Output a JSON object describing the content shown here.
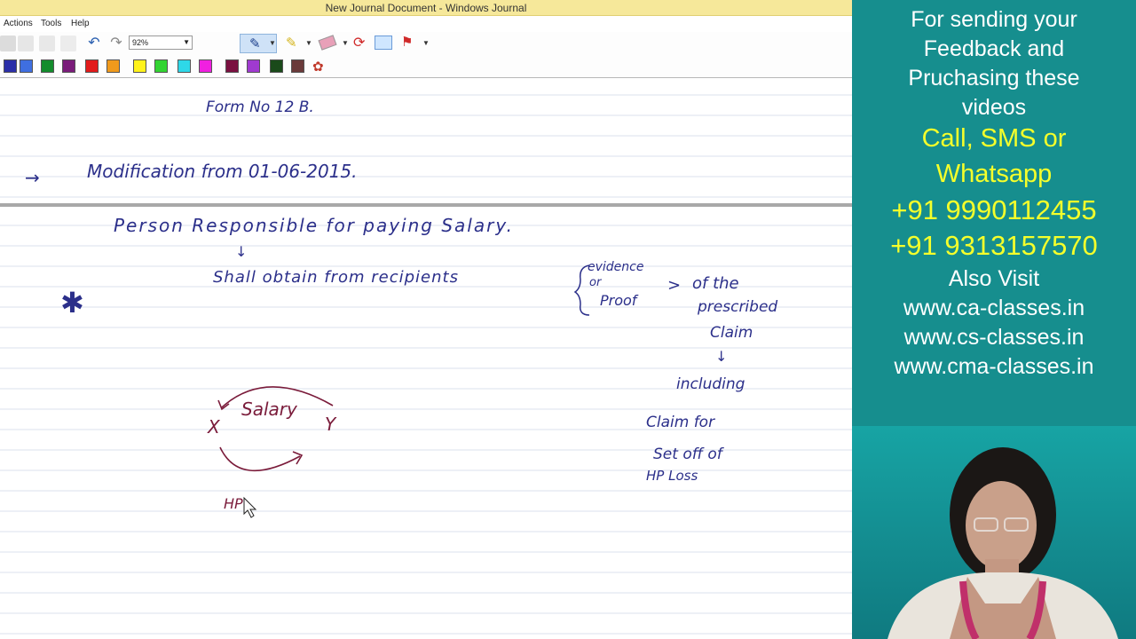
{
  "window": {
    "title": "New Journal Document - Windows Journal"
  },
  "menu": [
    "Actions",
    "Tools",
    "Help"
  ],
  "toolbar": {
    "zoom": "92%"
  },
  "palette": [
    "#2b2fa8",
    "#3f6fe0",
    "#138c2c",
    "#7a1c7a",
    "#e21b1b",
    "#f09a1c",
    "#fff21b",
    "#32d432",
    "#2ed8e8",
    "#f020e0",
    "#7a1040",
    "#a03ad0",
    "#1a4a1a",
    "#6a3a3a"
  ],
  "notes": {
    "line1": "Form No 12 B.",
    "line2_arrow": "→",
    "line2": "Modification from 01-06-2015.",
    "line3": "Person Responsible for paying Salary.",
    "line4": "Shall obtain from recipients",
    "brace_top": "evidence",
    "brace_mid": "or",
    "brace_bot": "Proof",
    "of_the": "of the",
    "prescribed": "prescribed",
    "claim": "Claim",
    "including": "including",
    "claim_for": "Claim for",
    "set_off": "Set off of",
    "hp_loss": "HP Loss",
    "star": "✱",
    "diagram_label": "Salary",
    "diagram_x": "X",
    "diagram_y": "Y",
    "diagram_hp": "HP"
  },
  "promo": {
    "l1": "For sending your",
    "l2": "Feedback and",
    "l3": "Pruchasing these",
    "l4": "videos",
    "l5": "Call, SMS or",
    "l6": "Whatsapp",
    "phone1": "+91 9990112455",
    "phone2": "+91 9313157570",
    "l9": "Also Visit",
    "w1": "www.ca-classes.in",
    "w2": "www.cs-classes.in",
    "w3": "www.cma-classes.in"
  }
}
